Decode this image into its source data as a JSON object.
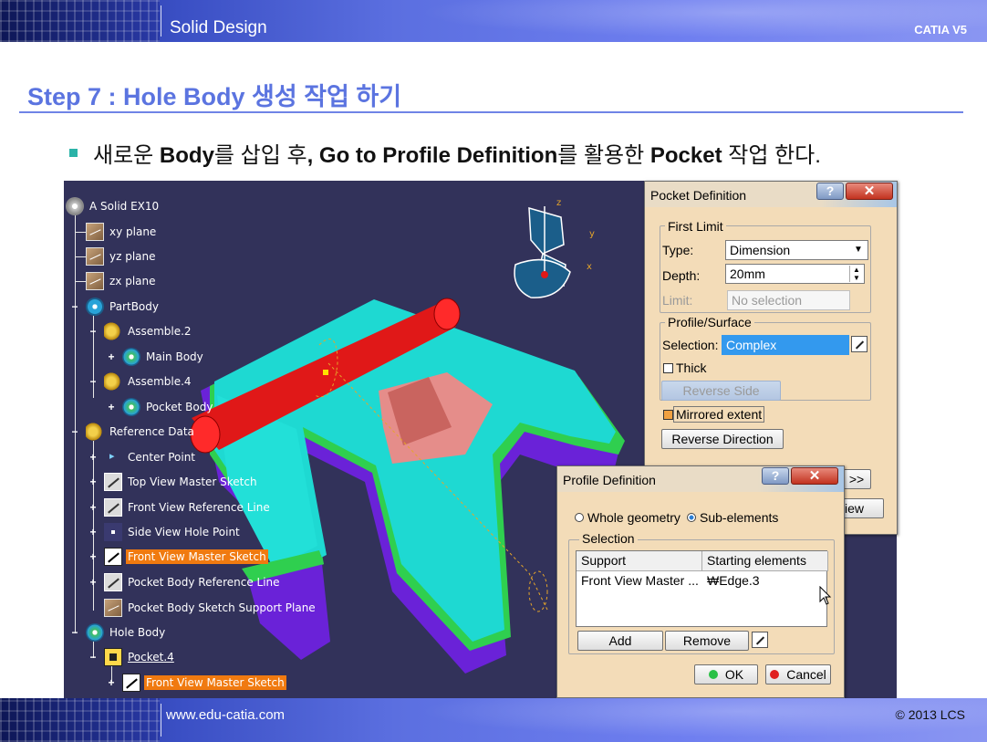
{
  "header": {
    "title": "Solid Design",
    "product": "CATIA V5"
  },
  "footer": {
    "url": "www.edu-catia.com",
    "copyright": "© 2013 LCS"
  },
  "slide": {
    "step_title": "Step 7 : Hole Body 생성 작업 하기",
    "bullet": {
      "p1": "새로운 ",
      "b1": "Body",
      "p2": "를 삽입 후",
      "b2": ", Go to Profile Definition",
      "p3": "를 활용한 ",
      "b3": "Pocket",
      "p4": " 작업 한다."
    }
  },
  "tree": {
    "items": [
      {
        "label": "A Solid EX10"
      },
      {
        "label": "xy plane"
      },
      {
        "label": "yz plane"
      },
      {
        "label": "zx plane"
      },
      {
        "label": "PartBody"
      },
      {
        "label": "Assemble.2"
      },
      {
        "label": "Main Body"
      },
      {
        "label": "Assemble.4"
      },
      {
        "label": "Pocket Body"
      },
      {
        "label": "Reference Data"
      },
      {
        "label": "Center Point"
      },
      {
        "label": "Top View Master Sketch"
      },
      {
        "label": "Front View Reference Line"
      },
      {
        "label": "Side View Hole Point"
      },
      {
        "label": "Front View Master Sketch"
      },
      {
        "label": "Pocket Body Reference Line"
      },
      {
        "label": "Pocket Body Sketch Support Plane"
      },
      {
        "label": "Hole Body"
      },
      {
        "label": "Pocket.4"
      },
      {
        "label": "Front View Master Sketch"
      }
    ]
  },
  "compass": {
    "z": "z",
    "y": "y",
    "x": "x"
  },
  "pocket_dialog": {
    "title": "Pocket Definition",
    "help": "?",
    "close": "✕",
    "first_limit": "First Limit",
    "type_label": "Type:",
    "type_value": "Dimension",
    "depth_label": "Depth:",
    "depth_value": "20mm",
    "limit_label": "Limit:",
    "limit_value": "No selection",
    "profile_surface": "Profile/Surface",
    "selection_label": "Selection:",
    "selection_value": "Complex",
    "thick_label": "Thick",
    "reverse_side": "Reverse Side",
    "mirrored_extent": "Mirrored extent",
    "reverse_direction": "Reverse Direction",
    "more": ">>",
    "preview": "view"
  },
  "profile_dialog": {
    "title": "Profile Definition",
    "help": "?",
    "close": "✕",
    "whole_geometry": "Whole geometry",
    "sub_elements": "Sub-elements",
    "selection": "Selection",
    "col_support": "Support",
    "col_starting": "Starting elements",
    "row_support": "Front View Master ...",
    "row_starting": "₩Edge.3",
    "add": "Add",
    "remove": "Remove",
    "ok": "OK",
    "cancel": "Cancel"
  }
}
